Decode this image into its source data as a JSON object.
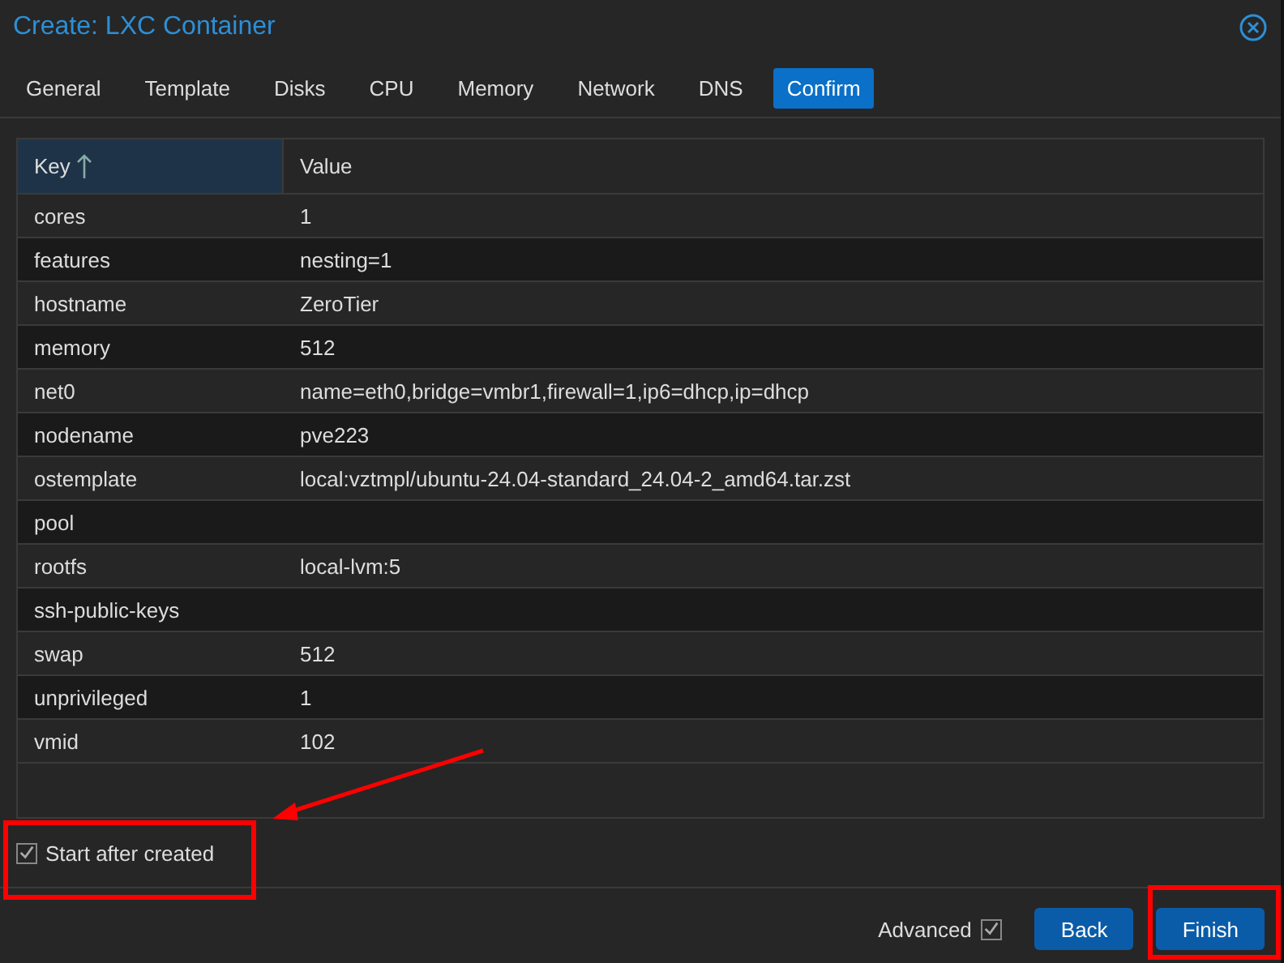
{
  "window": {
    "title": "Create: LXC Container"
  },
  "tabs": [
    {
      "label": "General",
      "selected": false
    },
    {
      "label": "Template",
      "selected": false
    },
    {
      "label": "Disks",
      "selected": false
    },
    {
      "label": "CPU",
      "selected": false
    },
    {
      "label": "Memory",
      "selected": false
    },
    {
      "label": "Network",
      "selected": false
    },
    {
      "label": "DNS",
      "selected": false
    },
    {
      "label": "Confirm",
      "selected": true
    }
  ],
  "table": {
    "columns": [
      {
        "label": "Key",
        "sorted": true
      },
      {
        "label": "Value",
        "sorted": false
      }
    ],
    "rows": [
      {
        "key": "cores",
        "value": "1"
      },
      {
        "key": "features",
        "value": "nesting=1"
      },
      {
        "key": "hostname",
        "value": "ZeroTier"
      },
      {
        "key": "memory",
        "value": "512"
      },
      {
        "key": "net0",
        "value": "name=eth0,bridge=vmbr1,firewall=1,ip6=dhcp,ip=dhcp"
      },
      {
        "key": "nodename",
        "value": "pve223"
      },
      {
        "key": "ostemplate",
        "value": "local:vztmpl/ubuntu-24.04-standard_24.04-2_amd64.tar.zst"
      },
      {
        "key": "pool"
      },
      {
        "key": "rootfs",
        "value": "local-lvm:5"
      },
      {
        "key": "ssh-public-keys"
      },
      {
        "key": "swap",
        "value": "512"
      },
      {
        "key": "unprivileged",
        "value": "1"
      },
      {
        "key": "vmid",
        "value": "102"
      }
    ]
  },
  "start_after_created": {
    "label": "Start after created",
    "checked": true
  },
  "advanced": {
    "label": "Advanced",
    "checked": true
  },
  "buttons": [
    {
      "label": "Back"
    },
    {
      "label": "Finish"
    }
  ]
}
